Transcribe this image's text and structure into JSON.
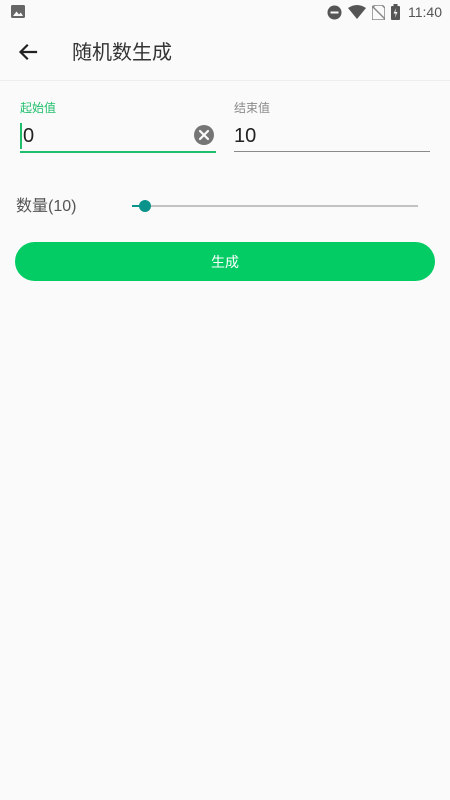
{
  "status_bar": {
    "time": "11:40",
    "icons": [
      "image-notification-icon",
      "do-not-disturb-icon",
      "wifi-icon",
      "no-sim-icon",
      "battery-charging-icon"
    ]
  },
  "toolbar": {
    "title": "随机数生成",
    "back_icon": "arrow-back-icon"
  },
  "form": {
    "start": {
      "label": "起始值",
      "value": "0"
    },
    "end": {
      "label": "结束值",
      "value": "10"
    }
  },
  "count": {
    "label": "数量(10)",
    "slider_fraction": 0.045
  },
  "generate_button": {
    "label": "生成"
  },
  "colors": {
    "accent": "#1fbe6c",
    "button": "#04cc64",
    "slider": "#0a938a",
    "background": "#fafafa"
  }
}
